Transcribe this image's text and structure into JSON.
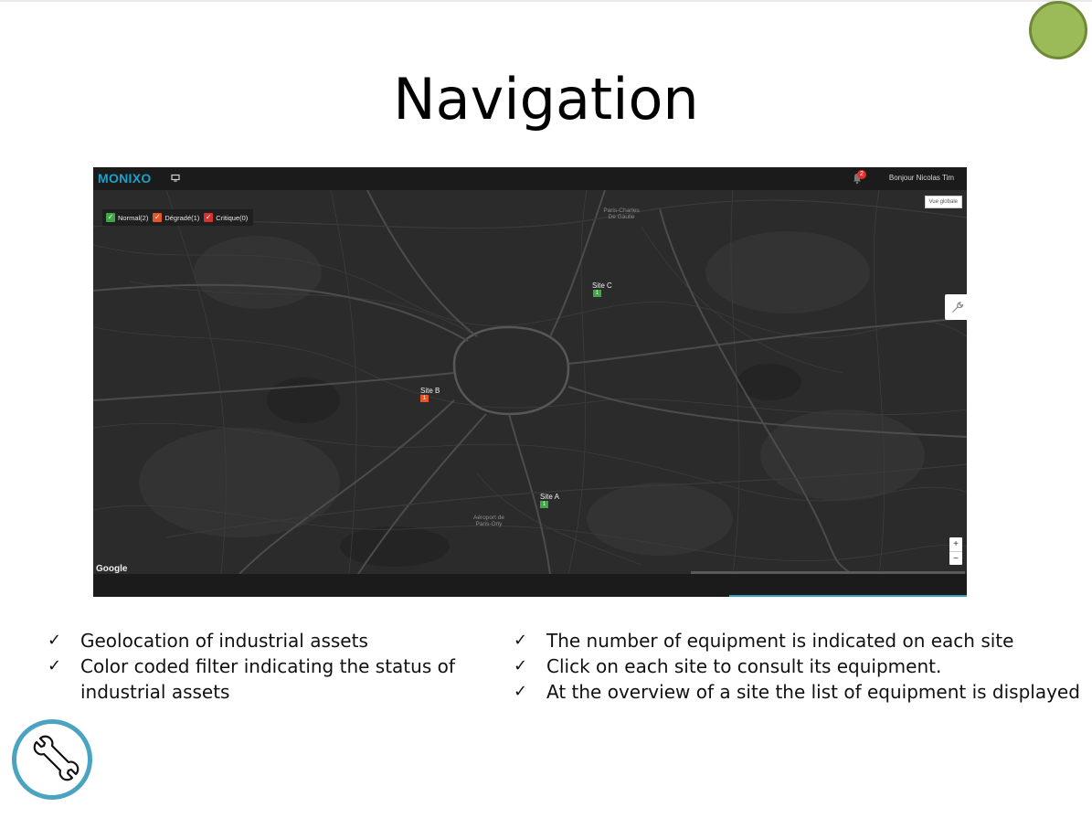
{
  "slide": {
    "title": "Navigation",
    "bullets_left": [
      "Geolocation of industrial assets",
      "Color coded filter indicating the status of industrial assets"
    ],
    "bullets_right": [
      "The number of equipment is indicated on each site",
      "Click on each site to consult its equipment.",
      "At the overview of a site the list of equipment is displayed"
    ],
    "check_glyph": "✓"
  },
  "app": {
    "brand": "MONIXO",
    "greeting": "Bonjour Nicolas Tim",
    "notification_count": "2",
    "global_view_label": "Vue globale",
    "map_provider": "Google",
    "filters": [
      {
        "label": "Normal(2)",
        "color": "#3fa845"
      },
      {
        "label": "Dégradé(1)",
        "color": "#e8552a"
      },
      {
        "label": "Critique(0)",
        "color": "#d9322e"
      }
    ],
    "sites": [
      {
        "name": "Site C",
        "count": "1",
        "color": "#3fa845"
      },
      {
        "name": "Site B",
        "count": "1",
        "color": "#e8552a"
      },
      {
        "name": "Site A",
        "count": "1",
        "color": "#3fa845"
      }
    ],
    "map_labels": {
      "cdg": "Paris-Charles\nDe Gaulle",
      "orly": "Aéroport de\nParis-Orly"
    },
    "zoom_in": "+",
    "zoom_out": "−"
  },
  "colors": {
    "accent_green": "#9bbb59",
    "brand_teal": "#1ba1c8",
    "logo_ring": "#4aa3c1"
  }
}
